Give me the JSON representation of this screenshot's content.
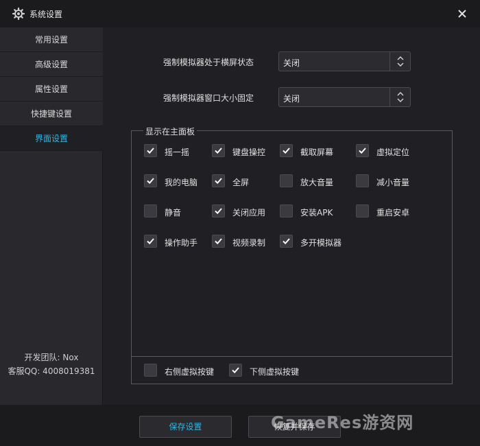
{
  "window": {
    "title": "系统设置"
  },
  "sidebar": {
    "items": [
      {
        "label": "常用设置",
        "active": false
      },
      {
        "label": "高级设置",
        "active": false
      },
      {
        "label": "属性设置",
        "active": false
      },
      {
        "label": "快捷键设置",
        "active": false
      },
      {
        "label": "界面设置",
        "active": true
      }
    ],
    "team": "开发团队: Nox",
    "support": "客服QQ: 4008019381"
  },
  "settings": [
    {
      "label": "强制模拟器处于横屏状态",
      "value": "关闭"
    },
    {
      "label": "强制模拟器窗口大小固定",
      "value": "关闭"
    }
  ],
  "panel": {
    "legend": "显示在主面板",
    "checkboxes": [
      {
        "label": "摇一摇",
        "checked": true
      },
      {
        "label": "键盘操控",
        "checked": true
      },
      {
        "label": "截取屏幕",
        "checked": true
      },
      {
        "label": "虚拟定位",
        "checked": true
      },
      {
        "label": "我的电脑",
        "checked": true
      },
      {
        "label": "全屏",
        "checked": true
      },
      {
        "label": "放大音量",
        "checked": false
      },
      {
        "label": "减小音量",
        "checked": false
      },
      {
        "label": "静音",
        "checked": false
      },
      {
        "label": "关闭应用",
        "checked": true
      },
      {
        "label": "安装APK",
        "checked": false
      },
      {
        "label": "重启安卓",
        "checked": false
      },
      {
        "label": "操作助手",
        "checked": true
      },
      {
        "label": "视频录制",
        "checked": true
      },
      {
        "label": "多开模拟器",
        "checked": true
      }
    ],
    "bottom_checkboxes": [
      {
        "label": "右侧虚拟按键",
        "checked": false
      },
      {
        "label": "下侧虚拟按键",
        "checked": true
      }
    ]
  },
  "footer": {
    "save_label": "保存设置",
    "reset_label": "恢复并保存"
  },
  "watermark": "GameRes游资网",
  "colors": {
    "accent": "#27b9e9",
    "background": "#202024",
    "sidebar": "#29292d"
  }
}
